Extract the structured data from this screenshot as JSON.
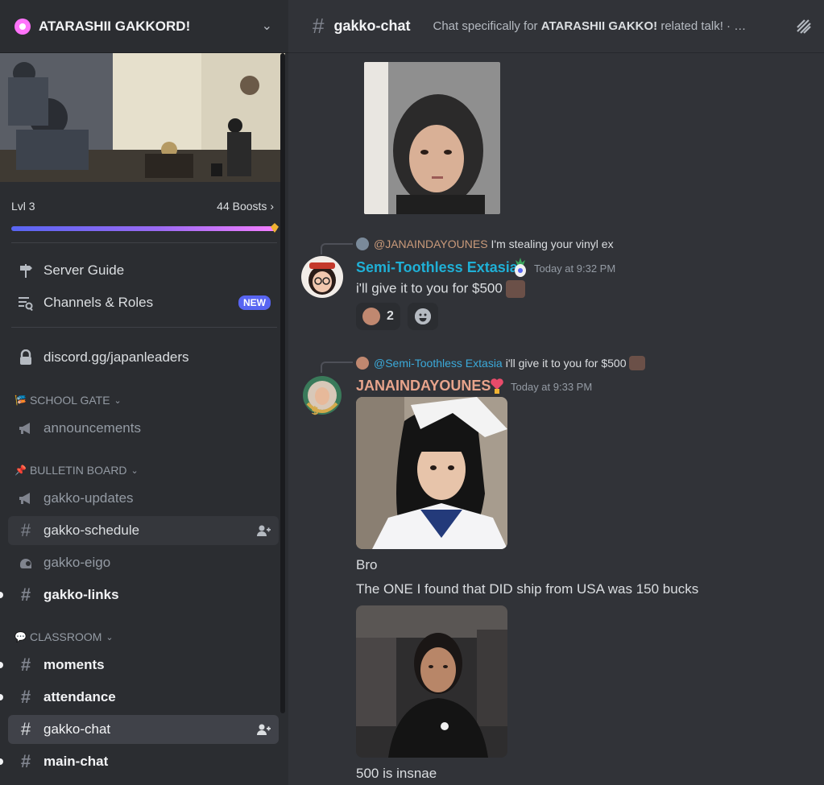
{
  "server": {
    "name": "ATARASHII GAKKORD!"
  },
  "boost": {
    "level": "Lvl 3",
    "count": "44 Boosts",
    "progress": 0.98
  },
  "nav": {
    "server_guide": "Server Guide",
    "channels_roles": "Channels & Roles",
    "new_badge": "NEW",
    "invite": "discord.gg/japanleaders"
  },
  "categories": {
    "school_gate": "SCHOOL GATE",
    "bulletin_board": "BULLETIN BOARD",
    "classroom": "CLASSROOM"
  },
  "channels": {
    "announcements": "announcements",
    "gakko_updates": "gakko-updates",
    "gakko_schedule": "gakko-schedule",
    "gakko_eigo": "gakko-eigo",
    "gakko_links": "gakko-links",
    "moments": "moments",
    "attendance": "attendance",
    "gakko_chat": "gakko-chat",
    "main_chat": "main-chat"
  },
  "header": {
    "channel": "gakko-chat",
    "topic_prefix": "Chat specifically for ",
    "topic_bold": "ATARASHII GAKKO!",
    "topic_suffix": " related talk! · …"
  },
  "messages": [
    {
      "reply_name": "@JANAINDAYOUNES",
      "reply_text": "I'm stealing your vinyl ex",
      "author": "Semi-Toothless Extasia",
      "time": "Today at 9:32 PM",
      "text": "i'll give it to you for $500",
      "reaction_count": "2"
    },
    {
      "reply_name": "@Semi-Toothless Extasia",
      "reply_text": "i'll give it to you for $500",
      "author": "JANAINDAYOUNES",
      "time": "Today at 9:33 PM",
      "lines": [
        "Bro",
        "The ONE I found that DID ship from USA was 150 bucks",
        "500 is insnae"
      ]
    }
  ],
  "colors": {
    "sidebar_bg": "#2b2d31",
    "chat_bg": "#313338",
    "selected_row": "#404249",
    "accent": "#5865f2",
    "username_teal": "#1fb0d6",
    "username_peach": "#e8a48c"
  }
}
